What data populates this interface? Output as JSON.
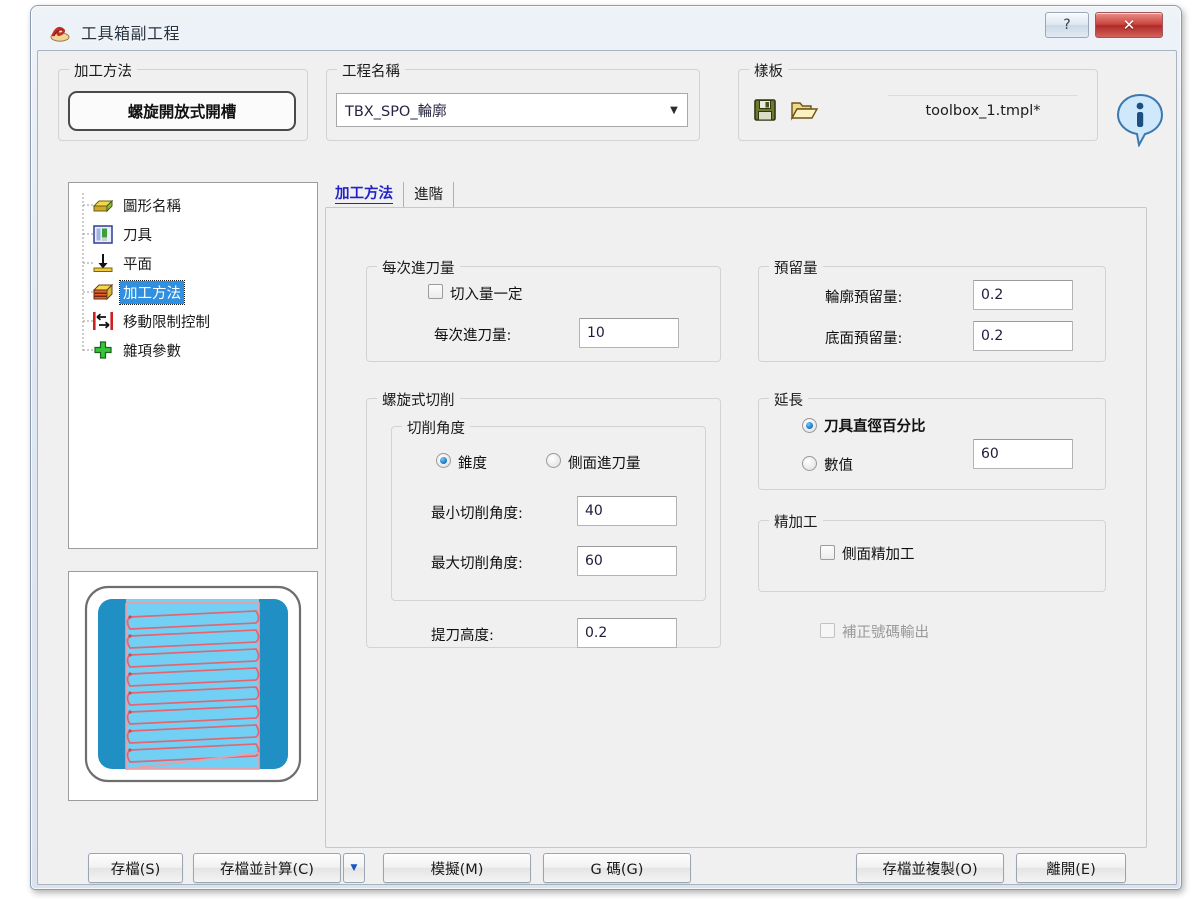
{
  "window": {
    "title": "工具箱副工程",
    "help_button": "?",
    "close_button": "✕",
    "app_icon": "spiral-tool-icon"
  },
  "method_group": {
    "title": "加工方法",
    "button_label": "螺旋開放式開槽"
  },
  "project_group": {
    "title": "工程名稱",
    "value": "TBX_SPO_輪廓",
    "dropdown_icon": "chevron-down-icon"
  },
  "template_group": {
    "title": "樣板",
    "save_icon": "floppy-save-icon",
    "open_icon": "folder-open-icon",
    "file_name": "toolbox_1.tmpl*",
    "info_icon": "info-icon"
  },
  "tree": {
    "items": [
      {
        "label": "圖形名稱",
        "icon": "shape-block-icon",
        "selected": false
      },
      {
        "label": "刀具",
        "icon": "tool-holder-icon",
        "selected": false
      },
      {
        "label": "平面",
        "icon": "plane-arrow-icon",
        "selected": false
      },
      {
        "label": "加工方法",
        "icon": "machining-layers-icon",
        "selected": true
      },
      {
        "label": "移動限制控制",
        "icon": "move-limit-icon",
        "selected": false
      },
      {
        "label": "雜項參數",
        "icon": "plus-green-icon",
        "selected": false
      }
    ]
  },
  "preview": {
    "icon": "toolpath-preview-zigzag"
  },
  "tabs": [
    {
      "label": "加工方法",
      "active": true
    },
    {
      "label": "進階",
      "active": false
    }
  ],
  "depth_group": {
    "title": "每次進刀量",
    "constant_checkbox_label": "切入量一定",
    "constant_checked": false,
    "field_label": "每次進刀量:",
    "field_value": "10"
  },
  "spiral_group": {
    "title": "螺旋式切削",
    "angle_group_title": "切削角度",
    "radio_taper": "錐度",
    "radio_side": "側面進刀量",
    "radio_selected": "錐度",
    "min_angle_label": "最小切削角度:",
    "min_angle_value": "40",
    "max_angle_label": "最大切削角度:",
    "max_angle_value": "60",
    "lift_label": "提刀高度:",
    "lift_value": "0.2"
  },
  "stock_group": {
    "title": "預留量",
    "contour_label": "輪廓預留量:",
    "contour_value": "0.2",
    "bottom_label": "底面預留量:",
    "bottom_value": "0.2"
  },
  "extend_group": {
    "title": "延長",
    "radio_percent": "刀具直徑百分比",
    "radio_value": "數值",
    "radio_selected": "刀具直徑百分比",
    "value": "60"
  },
  "finish_group": {
    "title": "精加工",
    "side_finish_label": "側面精加工",
    "side_finish_checked": false
  },
  "comp_output": {
    "label": "補正號碼輸出",
    "checked": false,
    "disabled": true
  },
  "footer": {
    "save": "存檔(S)",
    "save_calc": "存檔並計算(C)",
    "split_icon": "chevron-down-icon",
    "simulate": "模擬(M)",
    "gcode": "G 碼(G)",
    "save_copy": "存檔並複製(O)",
    "exit": "離開(E)"
  },
  "colors": {
    "accent_blue": "#2f8fe0",
    "tab_active": "#2222cc",
    "close_red": "#c9433c",
    "preview_stock": "#1f8fc4",
    "preview_pocket": "#72d0f4",
    "toolpath_red": "#e8606a"
  }
}
